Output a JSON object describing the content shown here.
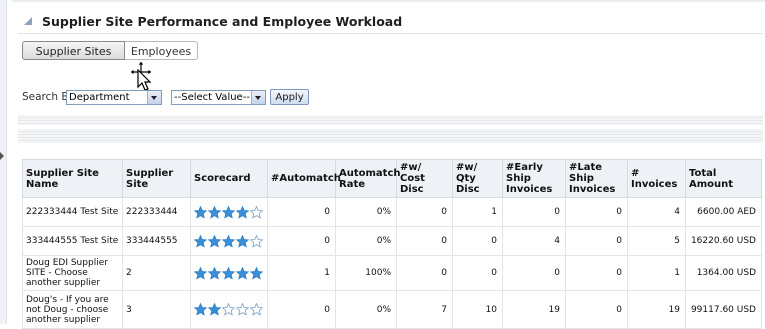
{
  "section": {
    "title": "Supplier Site Performance and Employee Workload"
  },
  "tabs": [
    {
      "label": "Supplier Sites",
      "active": true
    },
    {
      "label": "Employees",
      "active": false
    }
  ],
  "search": {
    "label": "Search By",
    "by_value": "Department",
    "value_placeholder": "--Select Value--",
    "apply_label": "Apply"
  },
  "colors": {
    "star_fill": "#3a8fd6",
    "header_bg": "#eef1f5",
    "accent": "#8fa3bd"
  },
  "table": {
    "headers": [
      "Supplier Site Name",
      "Supplier Site",
      "Scorecard",
      "#Automatch",
      "Automatch Rate",
      "#w/ Cost Disc",
      "#w/ Qty Disc",
      "#Early Ship Invoices",
      "#Late Ship Invoices",
      "# Invoices",
      "Total Amount"
    ],
    "rows": [
      {
        "name": "222333444 Test Site",
        "site": "222333444",
        "score": 4,
        "automatch": "0",
        "rate": "0%",
        "cost_disc": "0",
        "qty_disc": "1",
        "early": "0",
        "late": "0",
        "invoices": "4",
        "total": "6600.00 AED"
      },
      {
        "name": "333444555 Test Site",
        "site": "333444555",
        "score": 4,
        "automatch": "0",
        "rate": "0%",
        "cost_disc": "0",
        "qty_disc": "0",
        "early": "4",
        "late": "0",
        "invoices": "5",
        "total": "16220.60 USD"
      },
      {
        "name": "Doug EDI Supplier SITE - Choose another supplier",
        "site": "2",
        "score": 5,
        "automatch": "1",
        "rate": "100%",
        "cost_disc": "0",
        "qty_disc": "0",
        "early": "0",
        "late": "0",
        "invoices": "1",
        "total": "1364.00 USD"
      },
      {
        "name": "Doug's - If you are not Doug - choose another supplier",
        "site": "3",
        "score": 2,
        "automatch": "0",
        "rate": "0%",
        "cost_disc": "7",
        "qty_disc": "10",
        "early": "19",
        "late": "0",
        "invoices": "19",
        "total": "99117.60 USD"
      }
    ]
  }
}
